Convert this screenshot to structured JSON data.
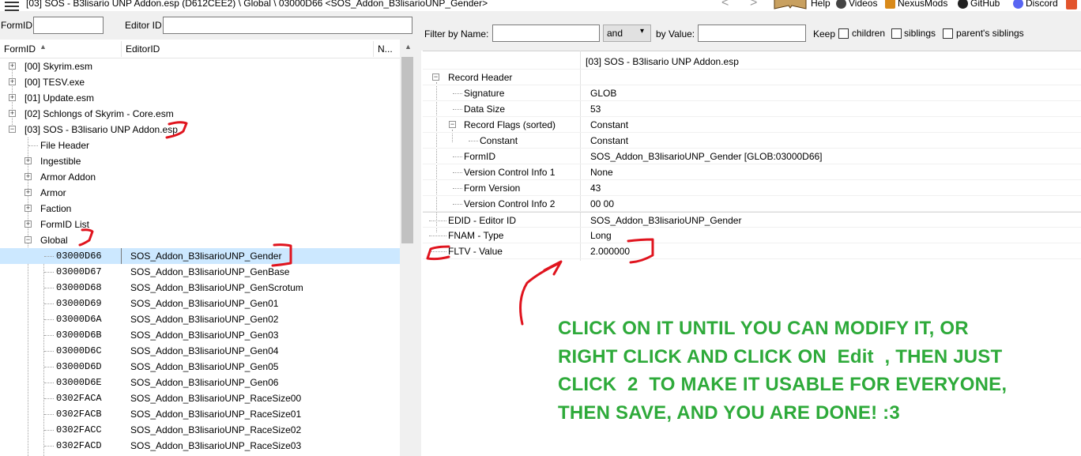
{
  "titlebar": {
    "title": "[03] SOS - B3lisario UNP Addon.esp (D612CEE2) \\ Global \\ 03000D66 <SOS_Addon_B3lisarioUNP_Gender>",
    "back": "<",
    "forward": ">",
    "links": [
      {
        "label": "Help",
        "icon": "book-icon"
      },
      {
        "label": "Videos",
        "icon": "video-icon"
      },
      {
        "label": "NexusMods",
        "icon": "nexus-icon"
      },
      {
        "label": "GitHub",
        "icon": "github-icon"
      },
      {
        "label": "Discord",
        "icon": "discord-icon"
      }
    ]
  },
  "left_filter": {
    "formid_label": "FormID",
    "formid_value": "",
    "editorid_label": "Editor ID",
    "editorid_value": ""
  },
  "columns": {
    "formid": "FormID",
    "editorid": "EditorID",
    "name": "N..."
  },
  "tree": [
    {
      "label": "[00] Skyrim.esm"
    },
    {
      "label": "[00] TESV.exe"
    },
    {
      "label": "[01] Update.esm"
    },
    {
      "label": "[02] Schlongs of Skyrim - Core.esm"
    },
    {
      "label": "[03] SOS - B3lisario UNP Addon.esp"
    },
    {
      "label": "File Header"
    },
    {
      "label": "Ingestible"
    },
    {
      "label": "Armor Addon"
    },
    {
      "label": "Armor"
    },
    {
      "label": "Faction"
    },
    {
      "label": "FormID List"
    },
    {
      "label": "Global"
    }
  ],
  "records": [
    {
      "formid": "03000D66",
      "editorid": "SOS_Addon_B3lisarioUNP_Gender"
    },
    {
      "formid": "03000D67",
      "editorid": "SOS_Addon_B3lisarioUNP_GenBase"
    },
    {
      "formid": "03000D68",
      "editorid": "SOS_Addon_B3lisarioUNP_GenScrotum"
    },
    {
      "formid": "03000D69",
      "editorid": "SOS_Addon_B3lisarioUNP_Gen01"
    },
    {
      "formid": "03000D6A",
      "editorid": "SOS_Addon_B3lisarioUNP_Gen02"
    },
    {
      "formid": "03000D6B",
      "editorid": "SOS_Addon_B3lisarioUNP_Gen03"
    },
    {
      "formid": "03000D6C",
      "editorid": "SOS_Addon_B3lisarioUNP_Gen04"
    },
    {
      "formid": "03000D6D",
      "editorid": "SOS_Addon_B3lisarioUNP_Gen05"
    },
    {
      "formid": "03000D6E",
      "editorid": "SOS_Addon_B3lisarioUNP_Gen06"
    },
    {
      "formid": "0302FACA",
      "editorid": "SOS_Addon_B3lisarioUNP_RaceSize00"
    },
    {
      "formid": "0302FACB",
      "editorid": "SOS_Addon_B3lisarioUNP_RaceSize01"
    },
    {
      "formid": "0302FACC",
      "editorid": "SOS_Addon_B3lisarioUNP_RaceSize02"
    },
    {
      "formid": "0302FACD",
      "editorid": "SOS_Addon_B3lisarioUNP_RaceSize03"
    }
  ],
  "right_filter": {
    "filter_name_label": "Filter by Name:",
    "filter_name_value": "",
    "operator": "and",
    "by_value_label": "by Value:",
    "by_value_value": "",
    "keep_label": "Keep",
    "children": "children",
    "siblings": "siblings",
    "parents_siblings": "parent's siblings"
  },
  "record_view": {
    "file_header": "[03] SOS - B3lisario UNP Addon.esp",
    "rows": [
      {
        "key": "Record Header",
        "value": ""
      },
      {
        "key": "Signature",
        "value": "GLOB"
      },
      {
        "key": "Data Size",
        "value": "53"
      },
      {
        "key": "Record Flags (sorted)",
        "value": "Constant"
      },
      {
        "key": "Constant",
        "value": "Constant"
      },
      {
        "key": "FormID",
        "value": "SOS_Addon_B3lisarioUNP_Gender [GLOB:03000D66]"
      },
      {
        "key": "Version Control Info 1",
        "value": "None"
      },
      {
        "key": "Form Version",
        "value": "43"
      },
      {
        "key": "Version Control Info 2",
        "value": "00 00"
      },
      {
        "key": "EDID - Editor ID",
        "value": "SOS_Addon_B3lisarioUNP_Gender"
      },
      {
        "key": "FNAM - Type",
        "value": "Long"
      },
      {
        "key": "FLTV - Value",
        "value": "2.000000"
      }
    ]
  },
  "annotation": {
    "color": "#2eaa3a",
    "lines": [
      "CLICK ON IT UNTIL YOU CAN MODIFY IT, OR",
      "RIGHT CLICK AND CLICK ON  Edit  , THEN JUST",
      "CLICK  2  TO MAKE IT USABLE FOR EVERYONE,",
      "THEN SAVE, AND YOU ARE DONE! :3"
    ]
  },
  "colors": {
    "selection": "#cce8ff",
    "marker": "#e0141e"
  }
}
